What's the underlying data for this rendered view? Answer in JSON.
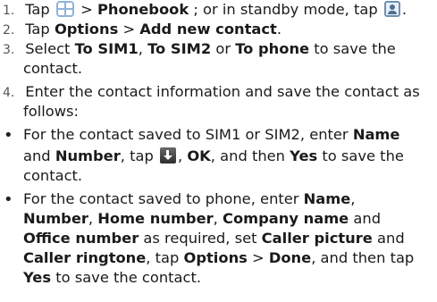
{
  "steps": {
    "s1": {
      "num": "1.",
      "a": "Tap ",
      "b": " > ",
      "phonebook": "Phonebook",
      "c": "; or in standby mode, tap ",
      "d": "."
    },
    "s2": {
      "num": "2.",
      "a": "Tap ",
      "options": "Options",
      "b": " > ",
      "add": "Add new contact",
      "c": "."
    },
    "s3": {
      "num": "3.",
      "a": "Select ",
      "sim1": "To SIM1",
      "b": ", ",
      "sim2": "To SIM2",
      "c": " or ",
      "phone": "To phone",
      "d": " to save the",
      "e": "contact."
    },
    "s4": {
      "num": "4.",
      "a": "Enter the contact information and save the contact as",
      "b": "follows:"
    }
  },
  "bullets": {
    "b1": {
      "a": "For the contact saved to SIM1 or SIM2, enter ",
      "name": "Name",
      "b": "and ",
      "number": "Number",
      "c": ", tap ",
      "d": ", ",
      "ok": "OK",
      "e": ", and then ",
      "yes": "Yes",
      "f": " to save the",
      "g": "contact."
    },
    "b2": {
      "a": "For the contact saved to phone, enter ",
      "name": "Name",
      "b": ",",
      "number": "Number",
      "c": ", ",
      "home": "Home number",
      "d": ", ",
      "company": "Company name",
      "e": " and",
      "office": "Office number",
      "f": " as required, set ",
      "picture": "Caller picture",
      "g": " and",
      "ringtone": "Caller ringtone",
      "h": ", tap ",
      "options": "Options",
      "i": " > ",
      "done": "Done",
      "j": ", and then tap",
      "yes": "Yes",
      "k": " to save the contact."
    }
  },
  "icons": [
    "menu-grid-icon",
    "phonebook-contact-icon",
    "save-download-icon"
  ],
  "colors": {
    "text": "#1a1a1a",
    "number": "#555555",
    "icon_blue": "#8fb3d9"
  }
}
